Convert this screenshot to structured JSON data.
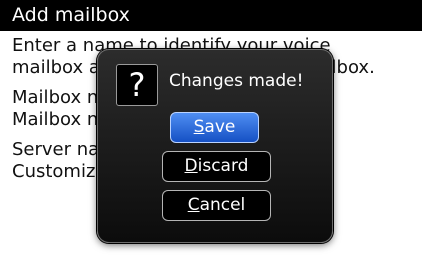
{
  "window": {
    "title": "Add mailbox"
  },
  "content": {
    "intro_line1": "Enter a name to identify your voice",
    "intro_line2": "mailbox and the number of the mailbox.",
    "mailbox_name": "Mailbox name: 108863222",
    "mailbox_number": "Mailbox number:",
    "server_name": "Server name: adapswitch.com",
    "customization": "Customization"
  },
  "dialog": {
    "icon": "question-icon",
    "icon_glyph": "?",
    "message": "Changes made!",
    "buttons": [
      {
        "mnemonic": "S",
        "rest": "ave",
        "label": "Save",
        "state": "focused"
      },
      {
        "mnemonic": "D",
        "rest": "iscard",
        "label": "Discard"
      },
      {
        "mnemonic": "C",
        "rest": "ancel",
        "label": "Cancel"
      }
    ]
  },
  "colors": {
    "titlebar_bg": "#000000",
    "focused_button": "#2f6fe0",
    "dialog_bg": "#1a1a1a"
  }
}
